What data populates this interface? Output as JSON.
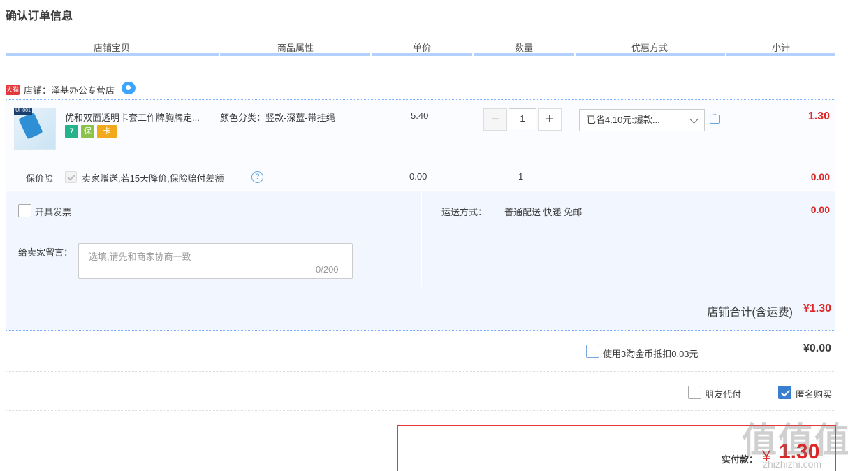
{
  "page_title": "确认订单信息",
  "columns": [
    "店铺宝贝",
    "商品属性",
    "单价",
    "数量",
    "优惠方式",
    "小计"
  ],
  "shop": {
    "badge": "天猫",
    "label": "店铺：泽基办公专营店"
  },
  "item": {
    "thumb_tag": "UH001",
    "title": "优和双面透明卡套工作牌胸牌定...",
    "service_icons": [
      "7",
      "保",
      "卡"
    ],
    "sku": "颜色分类：竖款-深蓝-带挂绳",
    "unit_price": "5.40",
    "qty_minus": "−",
    "qty": "1",
    "qty_plus": "+",
    "promo": "已省4.10元:爆款...",
    "subtotal": "1.30"
  },
  "insurance": {
    "label": "保价险",
    "text": "卖家赠送,若15天降价,保险赔付差额",
    "help": "?",
    "price": "0.00",
    "qty": "1",
    "subtotal": "0.00"
  },
  "invoice": {
    "label": "开具发票"
  },
  "shipping": {
    "label": "运送方式：",
    "value": "普通配送 快递 免邮",
    "fee": "0.00"
  },
  "message": {
    "label": "给卖家留言：",
    "placeholder": "选填,请先和商家协商一致",
    "counter": "0/200"
  },
  "shop_total": {
    "label": "店铺合计(含运费)",
    "value": "¥1.30"
  },
  "coins": {
    "label": "使用3淘金币抵扣0.03元",
    "value": "¥0.00"
  },
  "options": {
    "friend_pay": "朋友代付",
    "anonymous": "匿名购买"
  },
  "pay": {
    "label": "实付款：",
    "currency": "¥",
    "value": "1.30"
  },
  "watermark": {
    "text": "值值值",
    "sub": "zhizhizhi.com"
  },
  "colors": {
    "accent_blue": "#b2d1ff",
    "price_red": "#dd2727",
    "tmall_red": "#e4393c",
    "checkbox_blue": "#3a7ecf"
  }
}
